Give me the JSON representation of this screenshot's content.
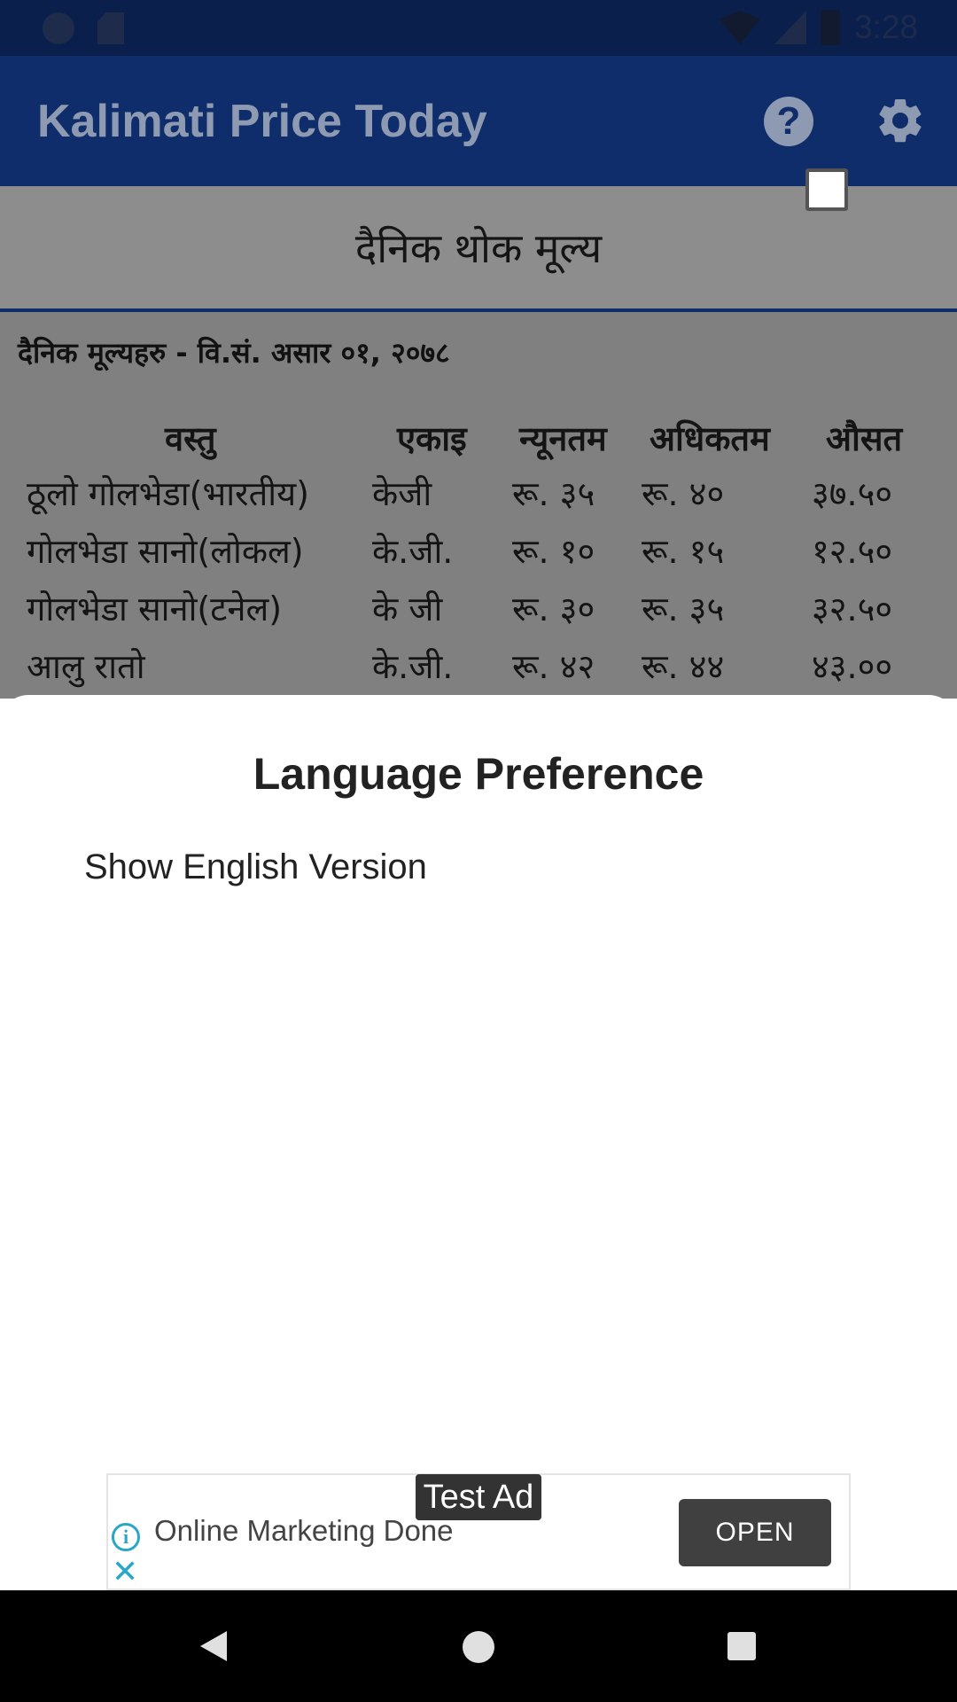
{
  "status_bar": {
    "time": "3:28",
    "icons": [
      "circle-icon",
      "sd-card-icon",
      "wifi-icon",
      "signal-icon",
      "battery-icon"
    ]
  },
  "app_bar": {
    "title": "Kalimati Price Today",
    "icons": [
      "help-icon",
      "gear-icon"
    ]
  },
  "page": {
    "section_title": "दैनिक थोक मूल्य",
    "date_line": "दैनिक मूल्यहरु - वि.सं. असार ०१, २०७८",
    "table": {
      "headers": [
        "वस्तु",
        "एकाइ",
        "न्यूनतम",
        "अधिकतम",
        "औसत"
      ],
      "rows": [
        [
          "ठूलो गोलभेडा(भारतीय)",
          "केजी",
          "रू. ३५",
          "रू. ४०",
          "३७.५०"
        ],
        [
          "गोलभेडा सानो(लोकल)",
          "के.जी.",
          "रू. १०",
          "रू. १५",
          "१२.५०"
        ],
        [
          "गोलभेडा सानो(टनेल)",
          "के जी",
          "रू. ३०",
          "रू. ३५",
          "३२.५०"
        ],
        [
          "आलु रातो",
          "के.जी.",
          "रू. ४२",
          "रू. ४४",
          "४३.००"
        ]
      ]
    }
  },
  "sheet": {
    "title": "Language Preference",
    "option_label": "Show English Version",
    "option_checked": false
  },
  "ad": {
    "tag": "Test Ad",
    "text": "Online Marketing Done",
    "button": "OPEN",
    "info_glyph": "i",
    "close_glyph": "✕"
  },
  "colors": {
    "app_bar": "#0e2d6a",
    "status_bar": "#0b1f4d",
    "scrim_gray": "#808080",
    "ad_accent": "#2aa6c8"
  }
}
